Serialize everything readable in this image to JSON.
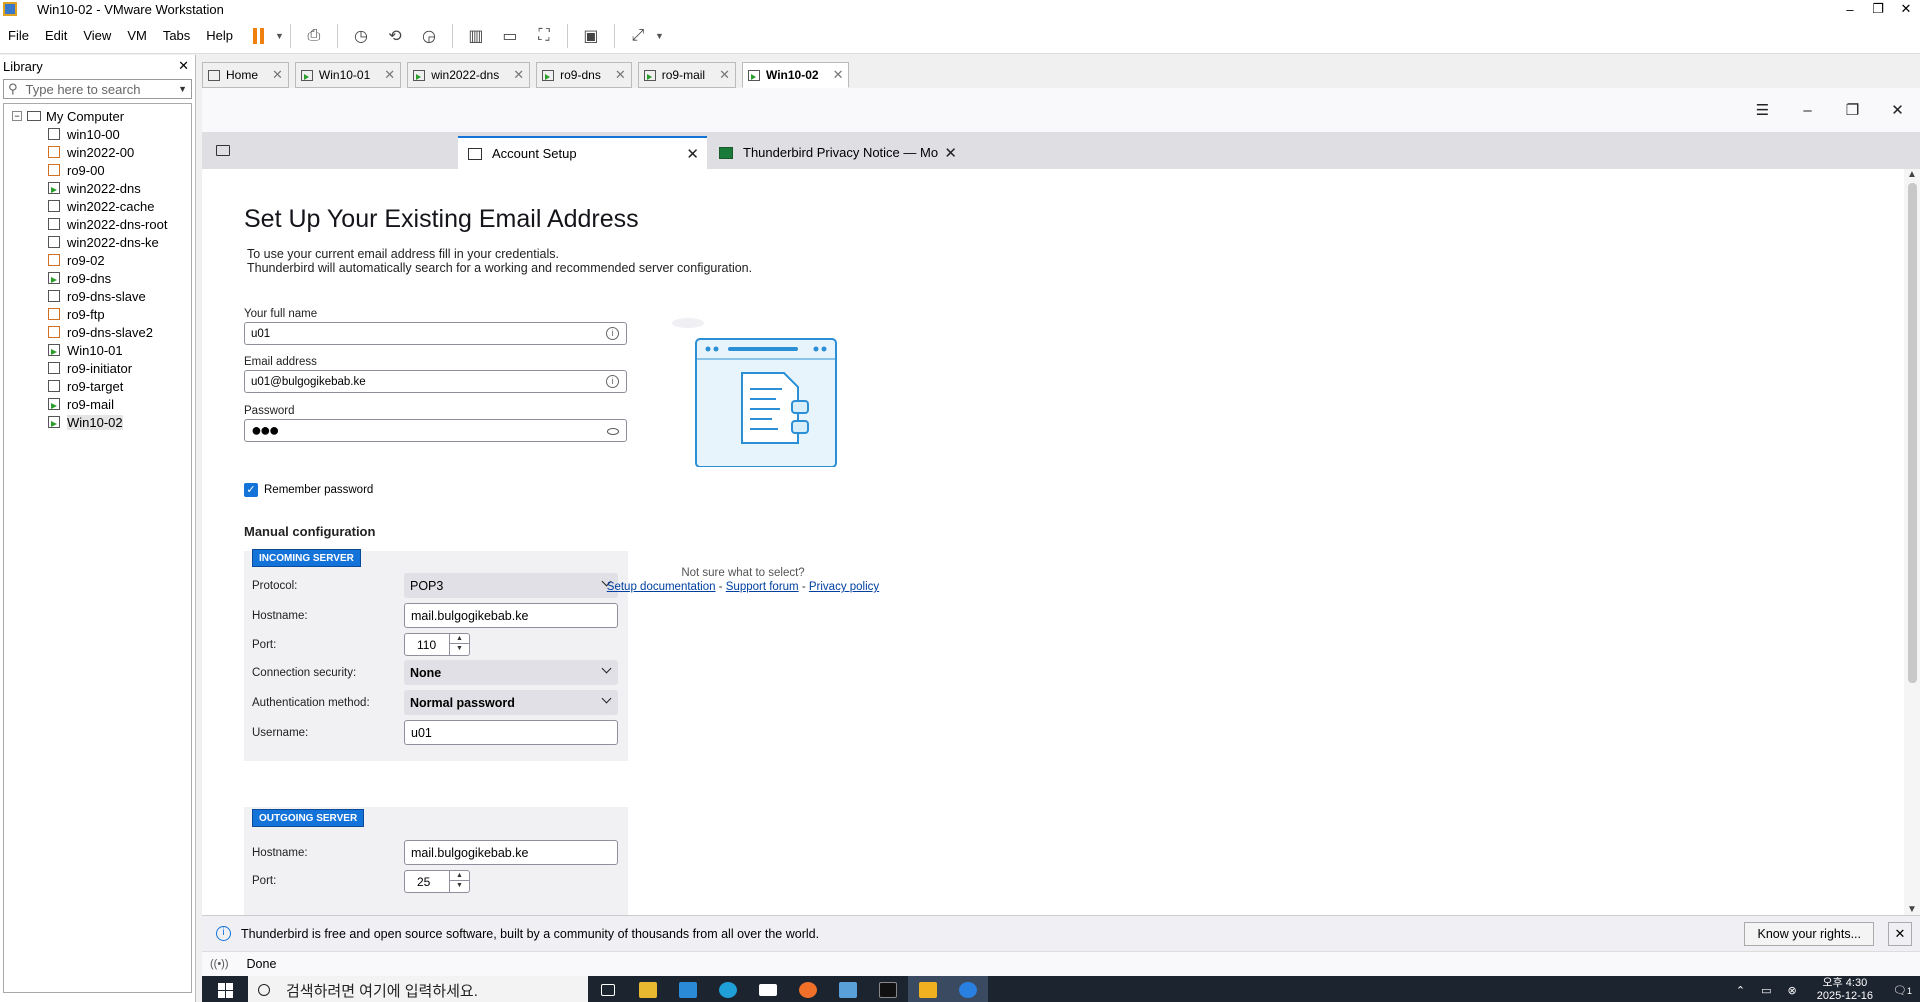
{
  "vmware": {
    "title": "Win10-02 - VMware Workstation",
    "menu": [
      "File",
      "Edit",
      "View",
      "VM",
      "Tabs",
      "Help"
    ],
    "library": {
      "title": "Library",
      "search_placeholder": "Type here to search",
      "root": "My Computer",
      "items": [
        {
          "label": "win10-00",
          "type": "win"
        },
        {
          "label": "win2022-00",
          "type": "lin"
        },
        {
          "label": "ro9-00",
          "type": "lin"
        },
        {
          "label": "win2022-dns",
          "type": "run"
        },
        {
          "label": "win2022-cache",
          "type": "win"
        },
        {
          "label": "win2022-dns-root",
          "type": "win"
        },
        {
          "label": "win2022-dns-ke",
          "type": "win"
        },
        {
          "label": "ro9-02",
          "type": "lin"
        },
        {
          "label": "ro9-dns",
          "type": "run"
        },
        {
          "label": "ro9-dns-slave",
          "type": "win"
        },
        {
          "label": "ro9-ftp",
          "type": "lin"
        },
        {
          "label": "ro9-dns-slave2",
          "type": "lin"
        },
        {
          "label": "Win10-01",
          "type": "run"
        },
        {
          "label": "ro9-initiator",
          "type": "win"
        },
        {
          "label": "ro9-target",
          "type": "win"
        },
        {
          "label": "ro9-mail",
          "type": "run"
        },
        {
          "label": "Win10-02",
          "type": "run",
          "selected": true
        }
      ]
    },
    "tabs": [
      {
        "label": "Home",
        "icon": "home"
      },
      {
        "label": "Win10-01",
        "icon": "run"
      },
      {
        "label": "win2022-dns",
        "icon": "run"
      },
      {
        "label": "ro9-dns",
        "icon": "run"
      },
      {
        "label": "ro9-mail",
        "icon": "run"
      },
      {
        "label": "Win10-02",
        "icon": "run",
        "active": true
      }
    ]
  },
  "thunderbird": {
    "tabs": [
      {
        "label": "Account Setup"
      },
      {
        "label": "Thunderbird Privacy Notice — Mo"
      }
    ],
    "page_title": "Set Up Your Existing Email Address",
    "subtitle_1": "To use your current email address fill in your credentials.",
    "subtitle_2": "Thunderbird will automatically search for a working and recommended server configuration.",
    "full_name": {
      "label": "Your full name",
      "value": "u01"
    },
    "email": {
      "label": "Email address",
      "value": "u01@bulgogikebab.ke"
    },
    "password": {
      "label": "Password",
      "value": "●●●"
    },
    "remember_password": {
      "label": "Remember password",
      "checked": true
    },
    "manual_config_title": "Manual configuration",
    "incoming": {
      "badge": "INCOMING SERVER",
      "protocol_label": "Protocol:",
      "protocol": "POP3",
      "hostname_label": "Hostname:",
      "hostname": "mail.bulgogikebab.ke",
      "port_label": "Port:",
      "port": "110",
      "security_label": "Connection security:",
      "security": "None",
      "auth_label": "Authentication method:",
      "auth": "Normal password",
      "username_label": "Username:",
      "username": "u01"
    },
    "outgoing": {
      "badge": "OUTGOING SERVER",
      "hostname_label": "Hostname:",
      "hostname": "mail.bulgogikebab.ke",
      "port_label": "Port:",
      "port": "25"
    },
    "help": {
      "not_sure": "Not sure what to select?",
      "setup_docs": "Setup documentation",
      "support_forum": "Support forum",
      "privacy_policy": "Privacy policy",
      "sep": "-"
    },
    "notification": {
      "text": "Thunderbird is free and open source software, built by a community of thousands from all over the world.",
      "button": "Know your rights..."
    },
    "status": "Done"
  },
  "taskbar": {
    "search_placeholder": "검색하려면 여기에 입력하세요.",
    "time": "오후 4:30",
    "date": "2025-12-16",
    "notif_count": "1"
  }
}
